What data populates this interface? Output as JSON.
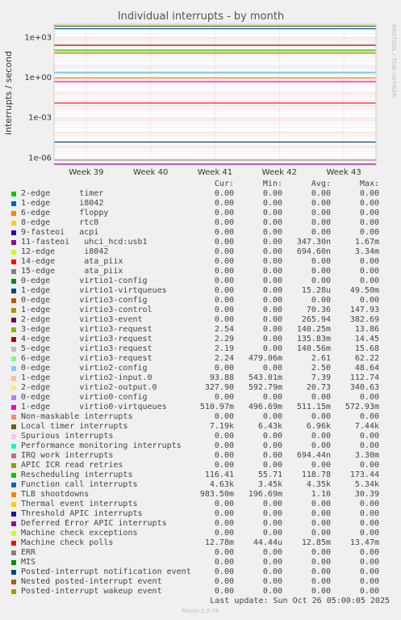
{
  "title": "Individual interrupts - by month",
  "ylabel": "interrupts / second",
  "side_label": "RRDTOOL / TOBI OETIKER",
  "headers": {
    "cur": "Cur:",
    "min": "Min:",
    "avg": "Avg:",
    "max": "Max:"
  },
  "footer": "Last update: Sun Oct 26 05:00:05 2025",
  "version": "Munin 2.0.76",
  "chart_data": {
    "type": "line",
    "title": "Individual interrupts - by month",
    "ylabel": "interrupts / second",
    "yscale": "log",
    "ylim": [
      3e-07,
      10000.0
    ],
    "y_ticks": [
      "1e-06",
      "1e-03",
      "1e+00",
      "1e+03"
    ],
    "x_ticks": [
      "Week 39",
      "Week 40",
      "Week 41",
      "Week 42",
      "Week 43"
    ],
    "grid": true,
    "legend_columns": [
      "Cur:",
      "Min:",
      "Avg:",
      "Max:"
    ],
    "series": [
      {
        "name": "2-edge      timer",
        "color": "#00cc00",
        "values": [
          "0.00",
          "0.00",
          "0.00",
          "0.00"
        ]
      },
      {
        "name": "1-edge      i8042",
        "color": "#0066b3",
        "values": [
          "0.00",
          "0.00",
          "0.00",
          "0.00"
        ]
      },
      {
        "name": "6-edge      floppy",
        "color": "#ff8000",
        "values": [
          "0.00",
          "0.00",
          "0.00",
          "0.00"
        ]
      },
      {
        "name": "8-edge      rtc0",
        "color": "#ffcc00",
        "values": [
          "0.00",
          "0.00",
          "0.00",
          "0.00"
        ]
      },
      {
        "name": "9-fasteoi   acpi",
        "color": "#330099",
        "values": [
          "0.00",
          "0.00",
          "0.00",
          "0.00"
        ]
      },
      {
        "name": "11-fasteoi   uhci_hcd:usb1",
        "color": "#990099",
        "values": [
          "0.00",
          "0.00",
          "347.30n",
          "1.67m"
        ]
      },
      {
        "name": "12-edge      i8042",
        "color": "#ccff00",
        "values": [
          "0.00",
          "0.00",
          "694.60n",
          "3.34m"
        ]
      },
      {
        "name": "14-edge      ata_piix",
        "color": "#ff0000",
        "values": [
          "0.00",
          "0.00",
          "0.00",
          "0.00"
        ]
      },
      {
        "name": "15-edge      ata_piix",
        "color": "#808080",
        "values": [
          "0.00",
          "0.00",
          "0.00",
          "0.00"
        ]
      },
      {
        "name": "0-edge      virtio1-config",
        "color": "#008f00",
        "values": [
          "0.00",
          "0.00",
          "0.00",
          "0.00"
        ]
      },
      {
        "name": "1-edge      virtio1-virtqueues",
        "color": "#00487d",
        "values": [
          "0.00",
          "0.00",
          "15.28u",
          "49.50m"
        ]
      },
      {
        "name": "0-edge      virtio3-config",
        "color": "#b35a00",
        "values": [
          "0.00",
          "0.00",
          "0.00",
          "0.00"
        ]
      },
      {
        "name": "1-edge      virtio3-control",
        "color": "#b38f00",
        "values": [
          "0.00",
          "0.00",
          "70.36",
          "147.93"
        ]
      },
      {
        "name": "2-edge      virtio3-event",
        "color": "#6b006b",
        "values": [
          "0.00",
          "0.00",
          "265.94",
          "382.69"
        ]
      },
      {
        "name": "3-edge      virtio3-request",
        "color": "#8fb300",
        "values": [
          "2.54",
          "0.00",
          "140.25m",
          "13.86"
        ]
      },
      {
        "name": "4-edge      virtio3-request",
        "color": "#b30000",
        "values": [
          "2.29",
          "0.00",
          "135.83m",
          "14.45"
        ]
      },
      {
        "name": "5-edge      virtio3-request",
        "color": "#bebebe",
        "values": [
          "2.19",
          "0.00",
          "140.56m",
          "15.68"
        ]
      },
      {
        "name": "6-edge      virtio3-request",
        "color": "#80ff80",
        "values": [
          "2.24",
          "479.06m",
          "2.61",
          "62.22"
        ]
      },
      {
        "name": "0-edge      virtio2-config",
        "color": "#80c9ff",
        "values": [
          "0.00",
          "0.00",
          "2.50",
          "48.64"
        ]
      },
      {
        "name": "1-edge      virtio2-input.0",
        "color": "#ffc080",
        "values": [
          "93.88",
          "543.01m",
          "7.39",
          "112.74"
        ]
      },
      {
        "name": "2-edge      virtio2-output.0",
        "color": "#ffe680",
        "values": [
          "327.90",
          "592.79m",
          "20.73",
          "340.63"
        ]
      },
      {
        "name": "0-edge      virtio0-config",
        "color": "#aa80ff",
        "values": [
          "0.00",
          "0.00",
          "0.00",
          "0.00"
        ]
      },
      {
        "name": "1-edge      virtio0-virtqueues",
        "color": "#ee00cc",
        "values": [
          "510.97m",
          "496.69m",
          "511.15m",
          "572.93m"
        ]
      },
      {
        "name": "Non-maskable interrupts",
        "color": "#ff8080",
        "values": [
          "0.00",
          "0.00",
          "0.00",
          "0.00"
        ]
      },
      {
        "name": "Local timer interrupts",
        "color": "#666600",
        "values": [
          "7.19k",
          "6.43k",
          "6.96k",
          "7.44k"
        ]
      },
      {
        "name": "Spurious interrupts",
        "color": "#ffbfff",
        "values": [
          "0.00",
          "0.00",
          "0.00",
          "0.00"
        ]
      },
      {
        "name": "Performance monitoring interrupts",
        "color": "#00ffcc",
        "values": [
          "0.00",
          "0.00",
          "0.00",
          "0.00"
        ]
      },
      {
        "name": "IRQ work interrupts",
        "color": "#cc6699",
        "values": [
          "0.00",
          "0.00",
          "694.44n",
          "3.30m"
        ]
      },
      {
        "name": "APIC ICR read retries",
        "color": "#999900",
        "values": [
          "0.00",
          "0.00",
          "0.00",
          "0.00"
        ]
      },
      {
        "name": "Rescheduling interrupts",
        "color": "#00cc00",
        "values": [
          "116.41",
          "55.71",
          "118.78",
          "173.44"
        ]
      },
      {
        "name": "Function call interrupts",
        "color": "#0066b3",
        "values": [
          "4.63k",
          "3.45k",
          "4.35k",
          "5.34k"
        ]
      },
      {
        "name": "TLB shootdowns",
        "color": "#ff8000",
        "values": [
          "983.50m",
          "196.69m",
          "1.10",
          "30.39"
        ]
      },
      {
        "name": "Thermal event interrupts",
        "color": "#ffcc00",
        "values": [
          "0.00",
          "0.00",
          "0.00",
          "0.00"
        ]
      },
      {
        "name": "Threshold APIC interrupts",
        "color": "#330099",
        "values": [
          "0.00",
          "0.00",
          "0.00",
          "0.00"
        ]
      },
      {
        "name": "Deferred Error APIC interrupts",
        "color": "#990099",
        "values": [
          "0.00",
          "0.00",
          "0.00",
          "0.00"
        ]
      },
      {
        "name": "Machine check exceptions",
        "color": "#ccff00",
        "values": [
          "0.00",
          "0.00",
          "0.00",
          "0.00"
        ]
      },
      {
        "name": "Machine check polls",
        "color": "#ff0000",
        "values": [
          "12.78m",
          "44.44u",
          "12.85m",
          "13.47m"
        ]
      },
      {
        "name": "ERR",
        "color": "#808080",
        "values": [
          "0.00",
          "0.00",
          "0.00",
          "0.00"
        ]
      },
      {
        "name": "MIS",
        "color": "#008f00",
        "values": [
          "0.00",
          "0.00",
          "0.00",
          "0.00"
        ]
      },
      {
        "name": "Posted-interrupt notification event",
        "color": "#00487d",
        "values": [
          "0.00",
          "0.00",
          "0.00",
          "0.00"
        ]
      },
      {
        "name": "Nested posted-interrupt event",
        "color": "#b35a00",
        "values": [
          "0.00",
          "0.00",
          "0.00",
          "0.00"
        ]
      },
      {
        "name": "Posted-interrupt wakeup event",
        "color": "#b38f00",
        "values": [
          "0.00",
          "0.00",
          "0.00",
          "0.00"
        ]
      }
    ]
  }
}
